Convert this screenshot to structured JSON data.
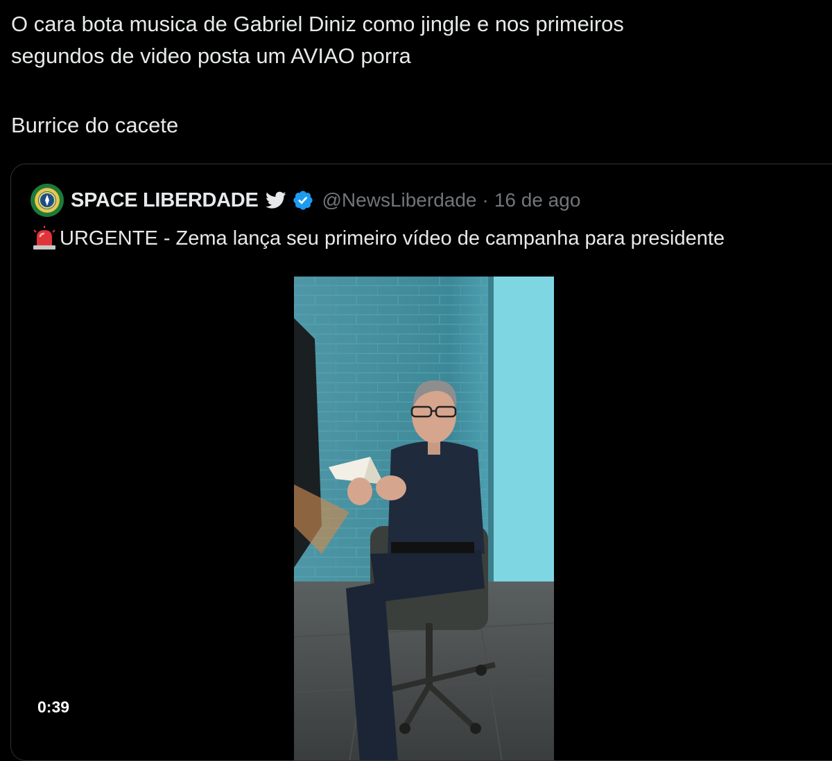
{
  "tweet": {
    "text_line1": "O cara bota musica de Gabriel Diniz como jingle e nos primeiros",
    "text_line2": "segundos de video posta um AVIAO porra",
    "text_line3": "Burrice do cacete"
  },
  "quoted_tweet": {
    "display_name": "SPACE LIBERDADE",
    "handle": "@NewsLiberdade",
    "separator": "·",
    "date": "16 de ago",
    "text": "URGENTE - Zema lança seu primeiro vídeo de campanha para presidente",
    "icons": [
      "bird-icon",
      "verified-icon",
      "siren-icon"
    ],
    "media": {
      "type": "video",
      "duration": "0:39"
    }
  },
  "colors": {
    "background": "#000000",
    "text_primary": "#e7e9ea",
    "text_secondary": "#71767b",
    "verified_blue": "#1d9bf0",
    "card_border": "#2f3336"
  }
}
